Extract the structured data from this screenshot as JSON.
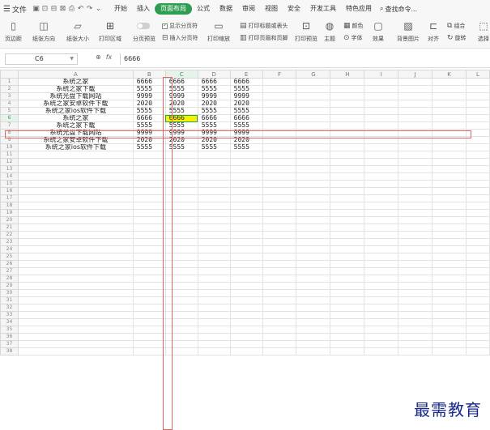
{
  "menubar": {
    "file_label": "文件",
    "tabs": [
      {
        "label": "开始",
        "active": false
      },
      {
        "label": "插入",
        "active": false
      },
      {
        "label": "页面布局",
        "active": true
      },
      {
        "label": "公式",
        "active": false
      },
      {
        "label": "数据",
        "active": false
      },
      {
        "label": "审阅",
        "active": false
      },
      {
        "label": "视图",
        "active": false
      },
      {
        "label": "安全",
        "active": false
      },
      {
        "label": "开发工具",
        "active": false
      },
      {
        "label": "特色应用",
        "active": false
      }
    ],
    "search_label": "查找命令..."
  },
  "ribbon": {
    "margins": "页边距",
    "orientation": "纸张方向",
    "size": "纸张大小",
    "print_area": "打印区域",
    "page_break_preview": "分页预览",
    "show_page_break": "显示分页符",
    "insert_page_break": "插入分页符",
    "print_scaling": "打印缩放",
    "print_title": "打印标题或表头",
    "print_header_footer": "打印页眉和页脚",
    "print_preview": "打印预览",
    "theme": "主题",
    "colors": "颜色",
    "fonts": "字体",
    "effects": "效果",
    "background": "背景图片",
    "align": "对齐",
    "group": "组合",
    "rotate": "旋转",
    "select": "选择"
  },
  "formula_bar": {
    "cell_ref": "C6",
    "fx_label": "fx",
    "value": "6666"
  },
  "sheet": {
    "columns": [
      "A",
      "B",
      "C",
      "D",
      "E",
      "F",
      "G",
      "H",
      "I",
      "J",
      "K",
      "L"
    ],
    "selected_column": "C",
    "selected_row": 6,
    "rows": [
      [
        "系统之家",
        "6666",
        "6666",
        "6666",
        "6666"
      ],
      [
        "系统之家下载",
        "5555",
        "5555",
        "5555",
        "5555"
      ],
      [
        "系统光盘下载网站",
        "9999",
        "9999",
        "9999",
        "9999"
      ],
      [
        "系统之家安卓软件下载",
        "2020",
        "2020",
        "2020",
        "2020"
      ],
      [
        "系统之家ios软件下载",
        "5555",
        "5555",
        "5555",
        "5555"
      ],
      [
        "系统之家",
        "6666",
        "6666",
        "6666",
        "6666"
      ],
      [
        "系统之家下载",
        "5555",
        "5555",
        "5555",
        "5555"
      ],
      [
        "系统光盘下载网站",
        "9999",
        "9999",
        "9999",
        "9999"
      ],
      [
        "系统之家安卓软件下载",
        "2020",
        "2020",
        "2020",
        "2020"
      ],
      [
        "系统之家ios软件下载",
        "5555",
        "5555",
        "5555",
        "5555"
      ]
    ],
    "total_rows": 38
  },
  "watermark": "最需教育"
}
